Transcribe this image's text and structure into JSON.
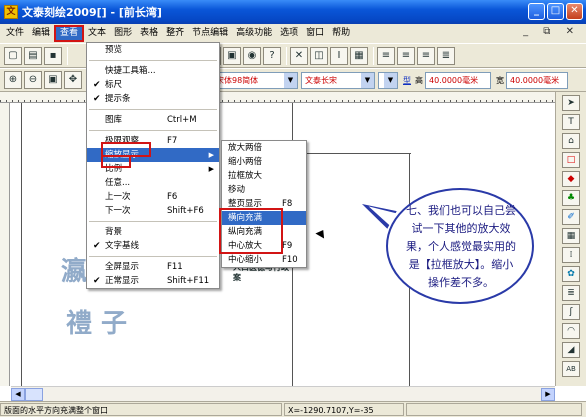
{
  "window": {
    "title": "文泰刻绘2009[] - [前长湾]",
    "buttons": [
      "_",
      "□",
      "✕"
    ]
  },
  "menubar": {
    "items": [
      "文件",
      "编辑",
      "查看",
      "文本",
      "图形",
      "表格",
      "整齐",
      "节点编辑",
      "高级功能",
      "选项",
      "窗口",
      "帮助"
    ],
    "active_index": 2,
    "mdi_controls": "_ ⧉ ✕"
  },
  "toolbar2": {
    "font_cn": "宋体98简体",
    "font_en": "文泰长宋",
    "style_label": "型",
    "height_label": "高",
    "height_value": "40.0000毫米",
    "width_label": "宽",
    "width_value": "40.0000毫米"
  },
  "view_menu": {
    "items": [
      {
        "label": "预览",
        "shortcut": "",
        "checked": false,
        "submenu": false
      },
      {
        "divider": true
      },
      {
        "label": "快捷工具箱...",
        "shortcut": "",
        "checked": false,
        "submenu": false
      },
      {
        "label": "标尺",
        "shortcut": "",
        "checked": true,
        "submenu": false
      },
      {
        "label": "提示条",
        "shortcut": "",
        "checked": true,
        "submenu": false
      },
      {
        "divider": true
      },
      {
        "label": "图库",
        "shortcut": "Ctrl+M",
        "checked": false,
        "submenu": false
      },
      {
        "divider": true
      },
      {
        "label": "极限观察",
        "shortcut": "F7",
        "checked": false,
        "submenu": false
      },
      {
        "label": "缩放显示",
        "shortcut": "",
        "checked": false,
        "submenu": true,
        "highlighted": true
      },
      {
        "label": "比例",
        "shortcut": "",
        "checked": false,
        "submenu": true
      },
      {
        "label": "任意...",
        "shortcut": "",
        "checked": false,
        "submenu": false
      },
      {
        "label": "上一次",
        "shortcut": "F6",
        "checked": false,
        "submenu": false
      },
      {
        "label": "下一次",
        "shortcut": "Shift+F6",
        "checked": false,
        "submenu": false
      },
      {
        "divider": true
      },
      {
        "label": "背景",
        "shortcut": "",
        "checked": false,
        "submenu": false
      },
      {
        "label": "文字基线",
        "shortcut": "",
        "checked": true,
        "submenu": false
      },
      {
        "divider": true
      },
      {
        "label": "全屏显示",
        "shortcut": "F11",
        "checked": false,
        "submenu": false
      },
      {
        "label": "正常显示",
        "shortcut": "Shift+F11",
        "checked": true,
        "submenu": false
      }
    ]
  },
  "zoom_submenu": {
    "items": [
      {
        "label": "放大两倍",
        "shortcut": ""
      },
      {
        "label": "缩小两倍",
        "shortcut": ""
      },
      {
        "label": "拉框放大",
        "shortcut": ""
      },
      {
        "label": "移动",
        "shortcut": ""
      },
      {
        "label": "整页显示",
        "shortcut": "F8"
      },
      {
        "label": "横向充满",
        "shortcut": "",
        "highlighted": true
      },
      {
        "label": "纵向充满",
        "shortcut": ""
      },
      {
        "label": "中心放大",
        "shortcut": "F9"
      },
      {
        "label": "中心缩小",
        "shortcut": "F10"
      }
    ]
  },
  "callout": {
    "text": "七、我们也可以自己尝试一下其他的放大效果，个人感觉最实用的是【拉框放大】。缩小操作差不多。"
  },
  "canvas": {
    "small_text": "人口医德与行政  案",
    "calligraphy_1": "瀛 浙",
    "calligraphy_2": "禮 子"
  },
  "statusbar": {
    "message": "版面的水平方向充满整个窗口",
    "coords": "X=-1290.7107,Y=-35"
  }
}
